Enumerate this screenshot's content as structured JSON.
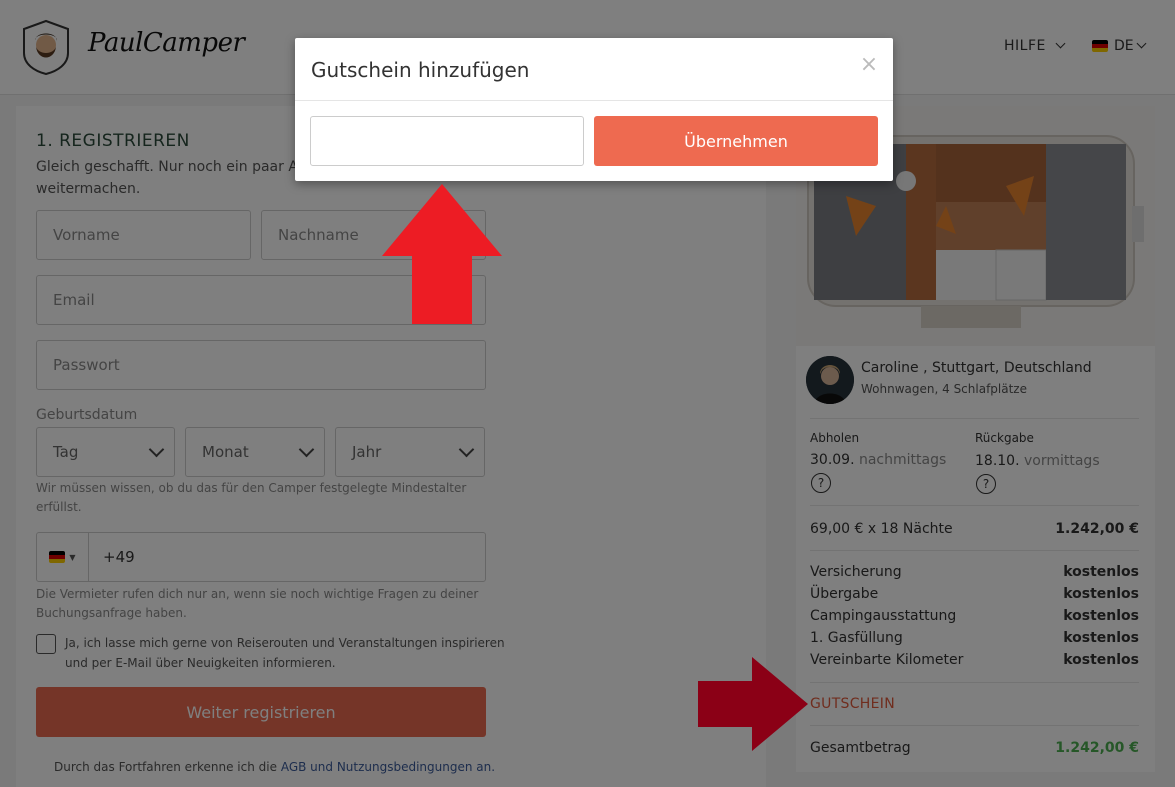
{
  "header": {
    "logo_text": "PaulCamper",
    "help_label": "HILFE",
    "lang_label": "DE"
  },
  "registration": {
    "section_title": "1. REGISTRIEREN",
    "intro_line1": "Gleich geschafft. Nur noch ein paar Anga",
    "intro_line2": "weitermachen.",
    "firstname_placeholder": "Vorname",
    "lastname_placeholder": "Nachname",
    "email_placeholder": "Email",
    "password_placeholder": "Passwort",
    "birthdate_label": "Geburtsdatum",
    "day_select": "Tag",
    "month_select": "Monat",
    "year_select": "Jahr",
    "birthdate_hint_line1": "Wir müssen wissen, ob du das für den Camper festgelegte Mindestalter",
    "birthdate_hint_line2": "erfüllst.",
    "phone_prefix": "+49",
    "phone_hint_line1": "Die Vermieter rufen dich nur an, wenn sie noch wichtige Fragen zu deiner",
    "phone_hint_line2": "Buchungsanfrage haben.",
    "newsletter_line1": "Ja, ich lasse mich gerne von Reiserouten und Veranstaltungen inspirieren",
    "newsletter_line2": "und per E-Mail über Neuigkeiten informieren.",
    "submit_label": "Weiter registrieren",
    "terms_prefix": "Durch das Fortfahren erkenne ich die",
    "terms_link": "AGB und Nutzungsbedingungen an."
  },
  "summary": {
    "host_name": "Caroline , Stuttgart, Deutschland",
    "host_vehicle": "Wohnwagen, 4 Schlafplätze",
    "pickup_label": "Abholen",
    "pickup_date": "30.09.",
    "pickup_time": "nachmittags",
    "return_label": "Rückgabe",
    "return_date": "18.10.",
    "return_time": "vormittags",
    "help_glyph": "?",
    "price_line": "69,00 € x 18 Nächte",
    "price_total": "1.242,00 €",
    "extras": [
      {
        "label": "Versicherung",
        "value": "kostenlos"
      },
      {
        "label": "Übergabe",
        "value": "kostenlos"
      },
      {
        "label": "Campingausstattung",
        "value": "kostenlos"
      },
      {
        "label": "1. Gasfüllung",
        "value": "kostenlos"
      },
      {
        "label": "Vereinbarte Kilometer",
        "value": "kostenlos"
      }
    ],
    "coupon_label": "GUTSCHEIN",
    "total_label": "Gesamtbetrag",
    "total_value": "1.242,00 €"
  },
  "modal": {
    "title": "Gutschein hinzufügen",
    "close_glyph": "×",
    "input_value": "",
    "apply_label": "Übernehmen"
  },
  "colors": {
    "accent": "#ee6a50",
    "coupon_text": "#e05a3c",
    "total_green": "#4caf50",
    "annotation_red": "#ed1c24",
    "annotation_dark_red": "#8b0016"
  },
  "icons": {
    "logo": "bearded-man-badge-icon",
    "help_dropdown": "chevron-down-icon",
    "flag": "germany-flag-icon",
    "select_chevron": "chevron-down-icon",
    "help": "question-circle-icon",
    "close": "close-icon"
  }
}
